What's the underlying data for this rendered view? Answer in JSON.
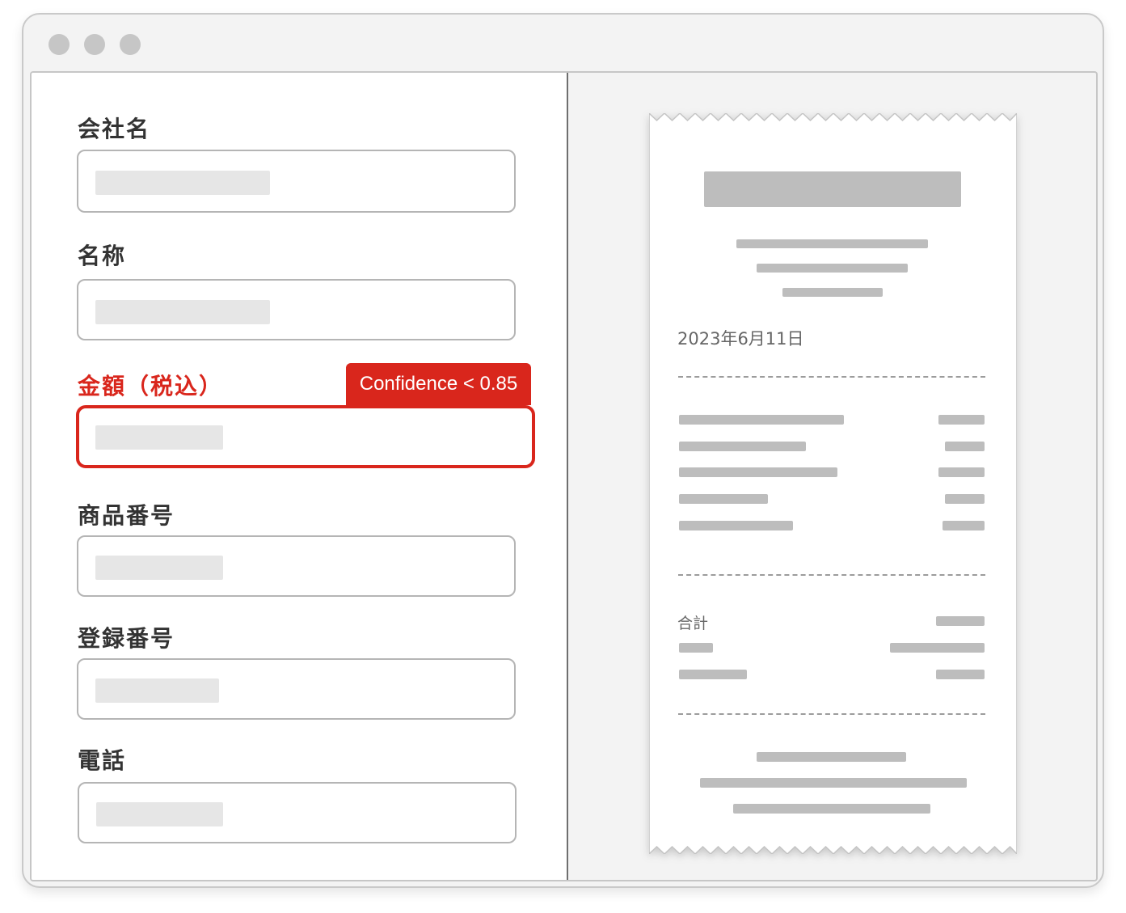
{
  "window": {
    "controls": [
      "close",
      "minimize",
      "maximize"
    ]
  },
  "form": {
    "fields": [
      {
        "label": "会社名",
        "error": false
      },
      {
        "label": "名称",
        "error": false
      },
      {
        "label": "金額（税込）",
        "error": true,
        "badge": "Confidence < 0.85"
      },
      {
        "label": "商品番号",
        "error": false
      },
      {
        "label": "登録番号",
        "error": false
      },
      {
        "label": "電話",
        "error": false
      }
    ]
  },
  "receipt": {
    "date": "2023年6月11日",
    "total_label": "合計"
  },
  "colors": {
    "error": "#d9261c",
    "placeholder": "#e6e6e6",
    "receipt_bar": "#bdbdbd"
  }
}
